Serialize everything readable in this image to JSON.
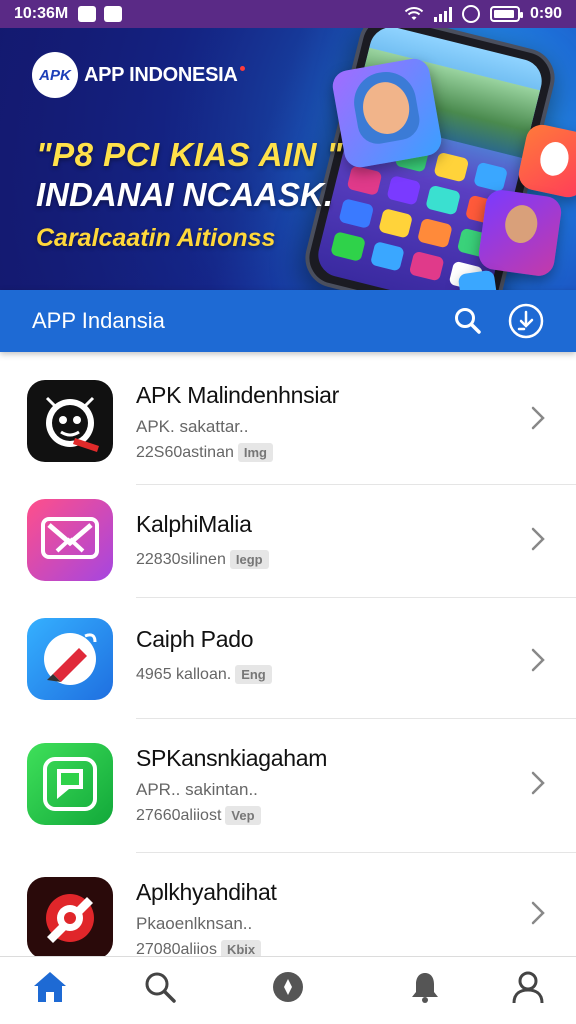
{
  "status_bar": {
    "time": "10:36M",
    "battery_time": "0:90",
    "battery_level": 0.9
  },
  "banner": {
    "brand_logo": "APK",
    "brand_name": "APP INDONESIA",
    "headline_line1": "\"P8 PCI KIAS AIN \"",
    "headline_line2": "INDANAI NCAASK.",
    "headline_line3": "Caralcaatin Aitionss"
  },
  "app_bar": {
    "title": "APP Indansia",
    "actions": [
      "search-icon",
      "download-icon"
    ]
  },
  "apps": [
    {
      "name": "APK Malindenhnsiar",
      "subtitle": "APK. sakattar..",
      "meta": "22S60astinan",
      "tag": "Img",
      "icon": "bomb-face-icon",
      "colors": [
        "#111111",
        "#ffffff",
        "#e02a2a"
      ]
    },
    {
      "name": "KalphiMalia",
      "subtitle": "",
      "meta": "22830silinen",
      "tag": "Iegp",
      "icon": "crossed-arrows-icon",
      "colors": [
        "#ff4f8a",
        "#a546e0",
        "#ffffff"
      ]
    },
    {
      "name": "Caiph Pado",
      "subtitle": "",
      "meta": "4965 kalloan.",
      "tag": "Eng",
      "icon": "pencil-tool-icon",
      "colors": [
        "#2a9cff",
        "#1f6fe0",
        "#ffffff"
      ]
    },
    {
      "name": "SPKansnkiagaham",
      "subtitle": "APR.. sakintan..",
      "meta": "27660aliiost",
      "tag": "Vep",
      "icon": "chat-bubble-icon",
      "colors": [
        "#2fd24a",
        "#12a83a",
        "#ffffff"
      ]
    },
    {
      "name": "Aplkhyahdihat",
      "subtitle": "Pkaoenlknsan..",
      "meta": "27080aliios",
      "tag": "Kbix",
      "icon": "swirl-logo-icon",
      "colors": [
        "#2a0a0a",
        "#e0262a",
        "#ffffff"
      ]
    }
  ],
  "bottom_nav": {
    "items": [
      "home-icon",
      "search-icon",
      "compass-icon",
      "bell-icon",
      "profile-icon"
    ],
    "active": "home-icon",
    "accent": "#1e6ad4"
  }
}
